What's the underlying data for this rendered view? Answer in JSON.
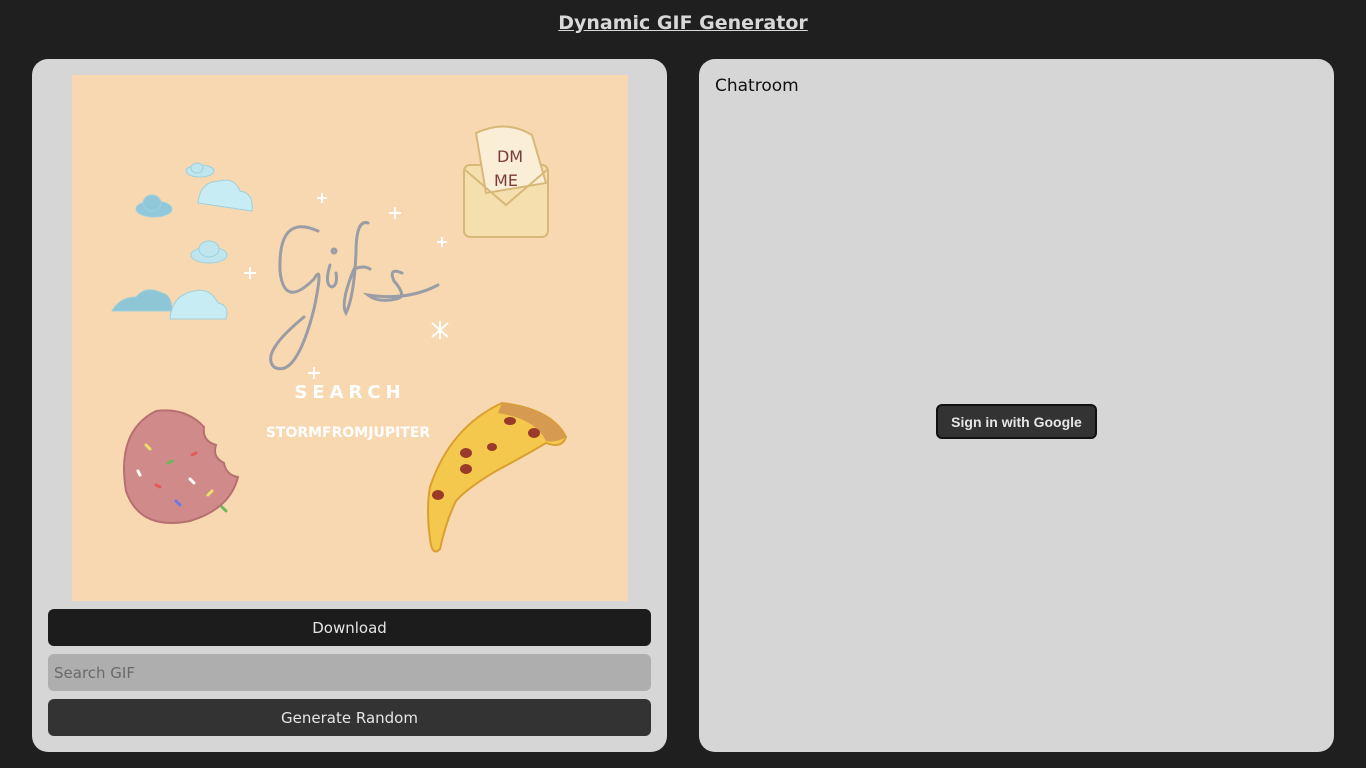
{
  "header": {
    "title": "Dynamic GIF Generator"
  },
  "gif_panel": {
    "image": {
      "icon": "gif-preview-image",
      "caption_search": "SEARCH",
      "caption_user": "STORMFROMJUPITER",
      "envelope_line1": "DM",
      "envelope_line2": "ME",
      "background_color": "#f8d8b0"
    },
    "download_label": "Download",
    "search": {
      "value": "",
      "placeholder": "Search GIF"
    },
    "random_label": "Generate Random"
  },
  "chat_panel": {
    "title": "Chatroom",
    "sign_in_label": "Sign in with Google"
  },
  "colors": {
    "page_bg": "#1f1f1f",
    "panel_bg": "#d6d6d6",
    "primary_button": "#1c1c1c",
    "secondary_button": "#333333",
    "input_bg": "#aeaeae"
  }
}
